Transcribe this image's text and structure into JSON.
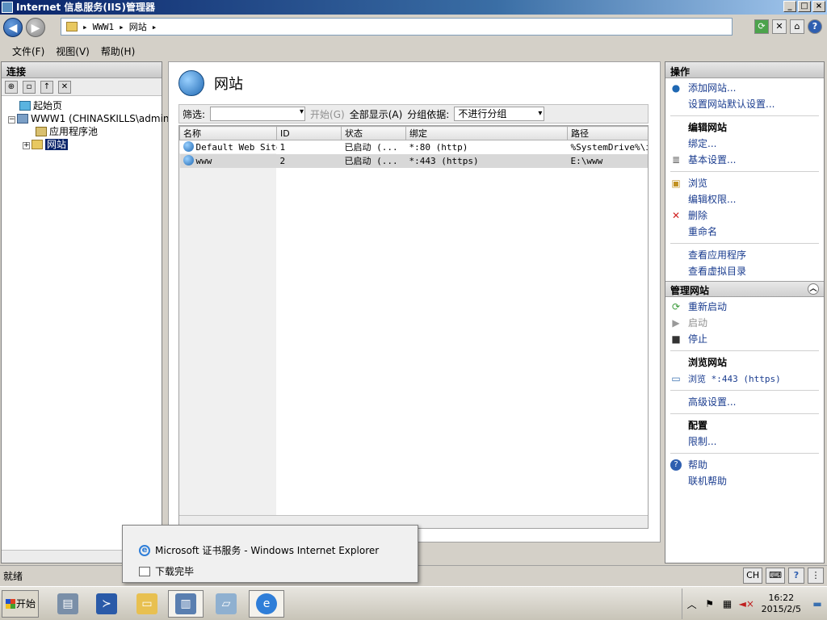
{
  "window": {
    "title": "Internet 信息服务(IIS)管理器",
    "min": "_",
    "max": "□",
    "close": "×"
  },
  "address": {
    "crumbs": [
      "WWW1",
      "网站"
    ],
    "sep": "▸"
  },
  "menu": [
    "文件(F)",
    "视图(V)",
    "帮助(H)"
  ],
  "connections": {
    "header": "连接",
    "tree": {
      "start_page": "起始页",
      "server": "WWW1 (CHINASKILLS\\administ",
      "app_pools": "应用程序池",
      "sites": "网站"
    }
  },
  "main": {
    "title": "网站",
    "filter_label": "筛选:",
    "start_label": "开始(G)",
    "show_all": "全部显示(A)",
    "group_label": "分组依据:",
    "group_value": "不进行分组",
    "columns": [
      "名称",
      "ID",
      "状态",
      "绑定",
      "路径"
    ],
    "rows": [
      {
        "name": "Default Web Site",
        "id": "1",
        "status": "已启动 (...",
        "binding": "*:80 (http)",
        "path": "%SystemDrive%\\in"
      },
      {
        "name": "www",
        "id": "2",
        "status": "已启动 (...",
        "binding": "*:443 (https)",
        "path": "E:\\www"
      }
    ]
  },
  "actions": {
    "header": "操作",
    "add_site": "添加网站...",
    "set_defaults": "设置网站默认设置...",
    "edit_site": "编辑网站",
    "bindings": "绑定...",
    "basic_settings": "基本设置...",
    "browse": "浏览",
    "edit_perms": "编辑权限...",
    "delete": "删除",
    "rename": "重命名",
    "view_apps": "查看应用程序",
    "view_vdirs": "查看虚拟目录",
    "manage_site": "管理网站",
    "restart": "重新启动",
    "start": "启动",
    "stop": "停止",
    "browse_site": "浏览网站",
    "browse_https": "浏览 *:443 (https)",
    "advanced": "高级设置...",
    "config": "配置",
    "limits": "限制...",
    "help": "帮助",
    "online_help": "联机帮助"
  },
  "status": {
    "text": "就绪",
    "lang": "CH"
  },
  "popup": {
    "ie_window": "Microsoft 证书服务 - Windows Internet Explorer",
    "download": "下载完毕"
  },
  "taskbar": {
    "start": "开始",
    "time": "16:22",
    "date": "2015/2/5"
  },
  "colors": {
    "title_from": "#0a246a",
    "link": "#1a3c8f",
    "selection": "#0a246a"
  }
}
